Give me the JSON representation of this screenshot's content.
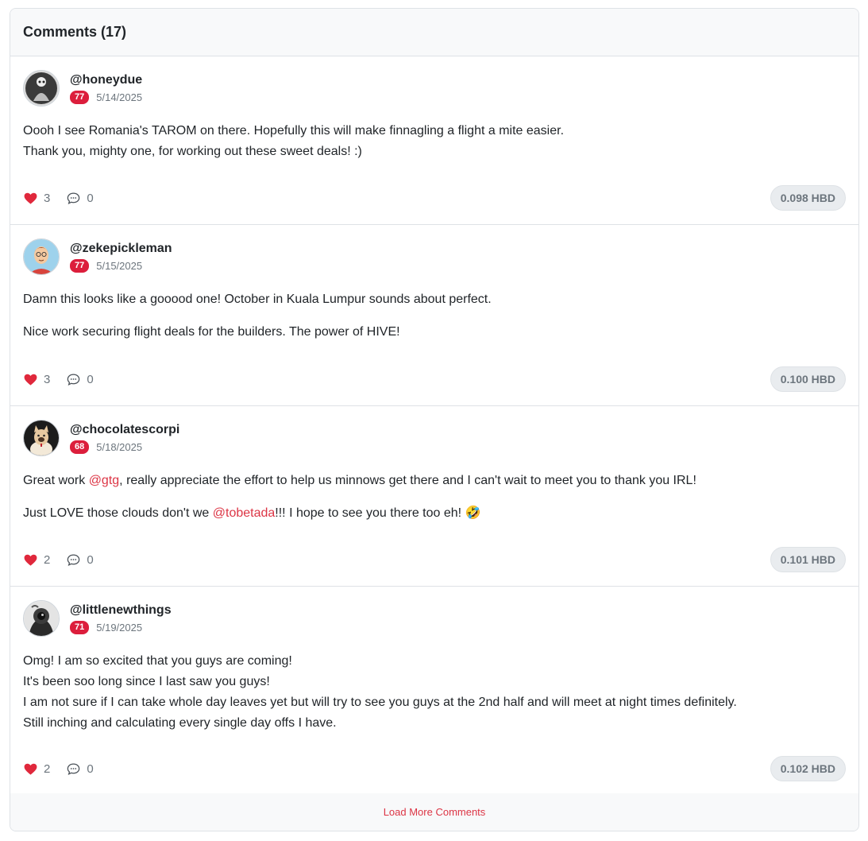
{
  "header": {
    "title": "Comments (17)"
  },
  "colors": {
    "accent": "#dc3545",
    "badge": "#dc1e3c",
    "muted": "#6c757d"
  },
  "comments": [
    {
      "username": "@honeydue",
      "reputation": "77",
      "date": "5/14/2025",
      "body": {
        "line1": "Oooh I see Romania's TAROM on there. Hopefully this will make finnagling a flight a mite easier.",
        "line2": "Thank you, mighty one, for working out these sweet deals! :)"
      },
      "likes": "3",
      "replies": "0",
      "payout": "0.098 HBD"
    },
    {
      "username": "@zekepickleman",
      "reputation": "77",
      "date": "5/15/2025",
      "body": {
        "p1": "Damn this looks like a gooood one! October in Kuala Lumpur sounds about perfect.",
        "p2": "Nice work securing flight deals for the builders. The power of HIVE!"
      },
      "likes": "3",
      "replies": "0",
      "payout": "0.100 HBD"
    },
    {
      "username": "@chocolatescorpi",
      "reputation": "68",
      "date": "5/18/2025",
      "body": {
        "p1_pre": "Great work ",
        "p1_mention": "@gtg",
        "p1_post": ", really appreciate the effort to help us minnows get there and I can't wait to meet you to thank you IRL!",
        "p2_pre": "Just LOVE those clouds don't we ",
        "p2_mention": "@tobetada",
        "p2_post": "!!! I hope to see you there too eh! 🤣"
      },
      "likes": "2",
      "replies": "0",
      "payout": "0.101 HBD"
    },
    {
      "username": "@littlenewthings",
      "reputation": "71",
      "date": "5/19/2025",
      "body": {
        "line1": "Omg! I am so excited that you guys are coming!",
        "line2": "It's been soo long since I last saw you guys!",
        "line3": "I am not sure if I can take whole day leaves yet but will try to see you guys at the 2nd half and will meet at night times definitely.",
        "line4": "Still inching and calculating every single day offs I have."
      },
      "likes": "2",
      "replies": "0",
      "payout": "0.102 HBD"
    }
  ],
  "load_more": "Load More Comments"
}
